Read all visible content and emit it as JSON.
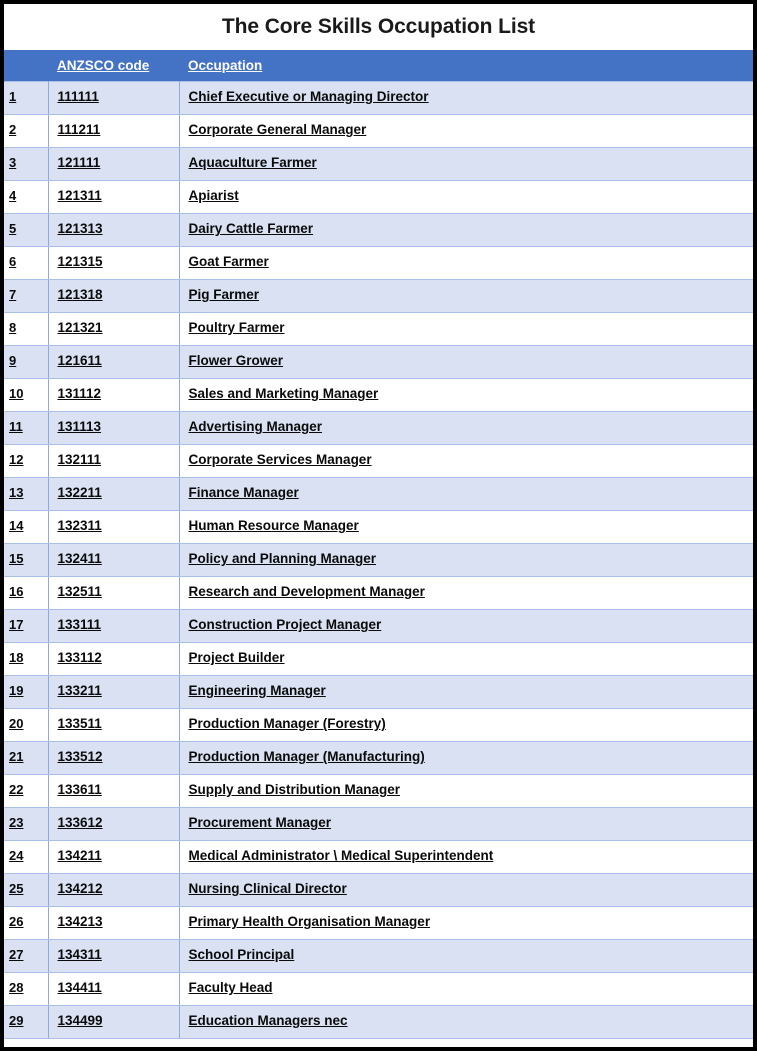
{
  "document": {
    "title": "The Core Skills Occupation List"
  },
  "colors": {
    "header_background": "#4472C4",
    "header_text": "#FFFFFF",
    "row_shaded": "#D9E1F2",
    "row_plain": "#FFFFFF",
    "cell_border": "#8EA9DB",
    "outer_border": "#000000",
    "body_text": "#0A0A0A"
  },
  "table": {
    "columns": [
      {
        "key": "index",
        "label": ""
      },
      {
        "key": "code",
        "label": "ANZSCO code"
      },
      {
        "key": "occupation",
        "label": "Occupation"
      }
    ],
    "row_count": 29,
    "rows": [
      {
        "index": "1",
        "code": "111111",
        "occupation": "Chief Executive or Managing Director"
      },
      {
        "index": "2",
        "code": "111211",
        "occupation": "Corporate General Manager"
      },
      {
        "index": "3",
        "code": "121111",
        "occupation": "Aquaculture Farmer"
      },
      {
        "index": "4",
        "code": "121311",
        "occupation": "Apiarist"
      },
      {
        "index": "5",
        "code": "121313",
        "occupation": "Dairy Cattle Farmer"
      },
      {
        "index": "6",
        "code": "121315",
        "occupation": "Goat Farmer"
      },
      {
        "index": "7",
        "code": "121318",
        "occupation": "Pig Farmer"
      },
      {
        "index": "8",
        "code": "121321",
        "occupation": "Poultry Farmer"
      },
      {
        "index": "9",
        "code": "121611",
        "occupation": "Flower Grower"
      },
      {
        "index": "10",
        "code": "131112",
        "occupation": "Sales and Marketing Manager"
      },
      {
        "index": "11",
        "code": "131113",
        "occupation": "Advertising Manager"
      },
      {
        "index": "12",
        "code": "132111",
        "occupation": "Corporate Services Manager"
      },
      {
        "index": "13",
        "code": "132211",
        "occupation": "Finance Manager"
      },
      {
        "index": "14",
        "code": "132311",
        "occupation": "Human Resource Manager"
      },
      {
        "index": "15",
        "code": "132411",
        "occupation": "Policy and Planning Manager"
      },
      {
        "index": "16",
        "code": "132511",
        "occupation": "Research and Development Manager"
      },
      {
        "index": "17",
        "code": "133111",
        "occupation": "Construction Project Manager"
      },
      {
        "index": "18",
        "code": "133112",
        "occupation": "Project Builder"
      },
      {
        "index": "19",
        "code": "133211",
        "occupation": "Engineering Manager"
      },
      {
        "index": "20",
        "code": "133511",
        "occupation": "Production Manager (Forestry)"
      },
      {
        "index": "21",
        "code": "133512",
        "occupation": "Production Manager (Manufacturing)"
      },
      {
        "index": "22",
        "code": "133611",
        "occupation": "Supply and Distribution Manager"
      },
      {
        "index": "23",
        "code": "133612",
        "occupation": "Procurement Manager"
      },
      {
        "index": "24",
        "code": "134211",
        "occupation": "Medical Administrator \\ Medical Superintendent"
      },
      {
        "index": "25",
        "code": "134212",
        "occupation": "Nursing Clinical Director"
      },
      {
        "index": "26",
        "code": "134213",
        "occupation": "Primary Health Organisation Manager"
      },
      {
        "index": "27",
        "code": "134311",
        "occupation": "School Principal"
      },
      {
        "index": "28",
        "code": "134411",
        "occupation": "Faculty Head"
      },
      {
        "index": "29",
        "code": "134499",
        "occupation": "Education Managers nec"
      }
    ]
  }
}
